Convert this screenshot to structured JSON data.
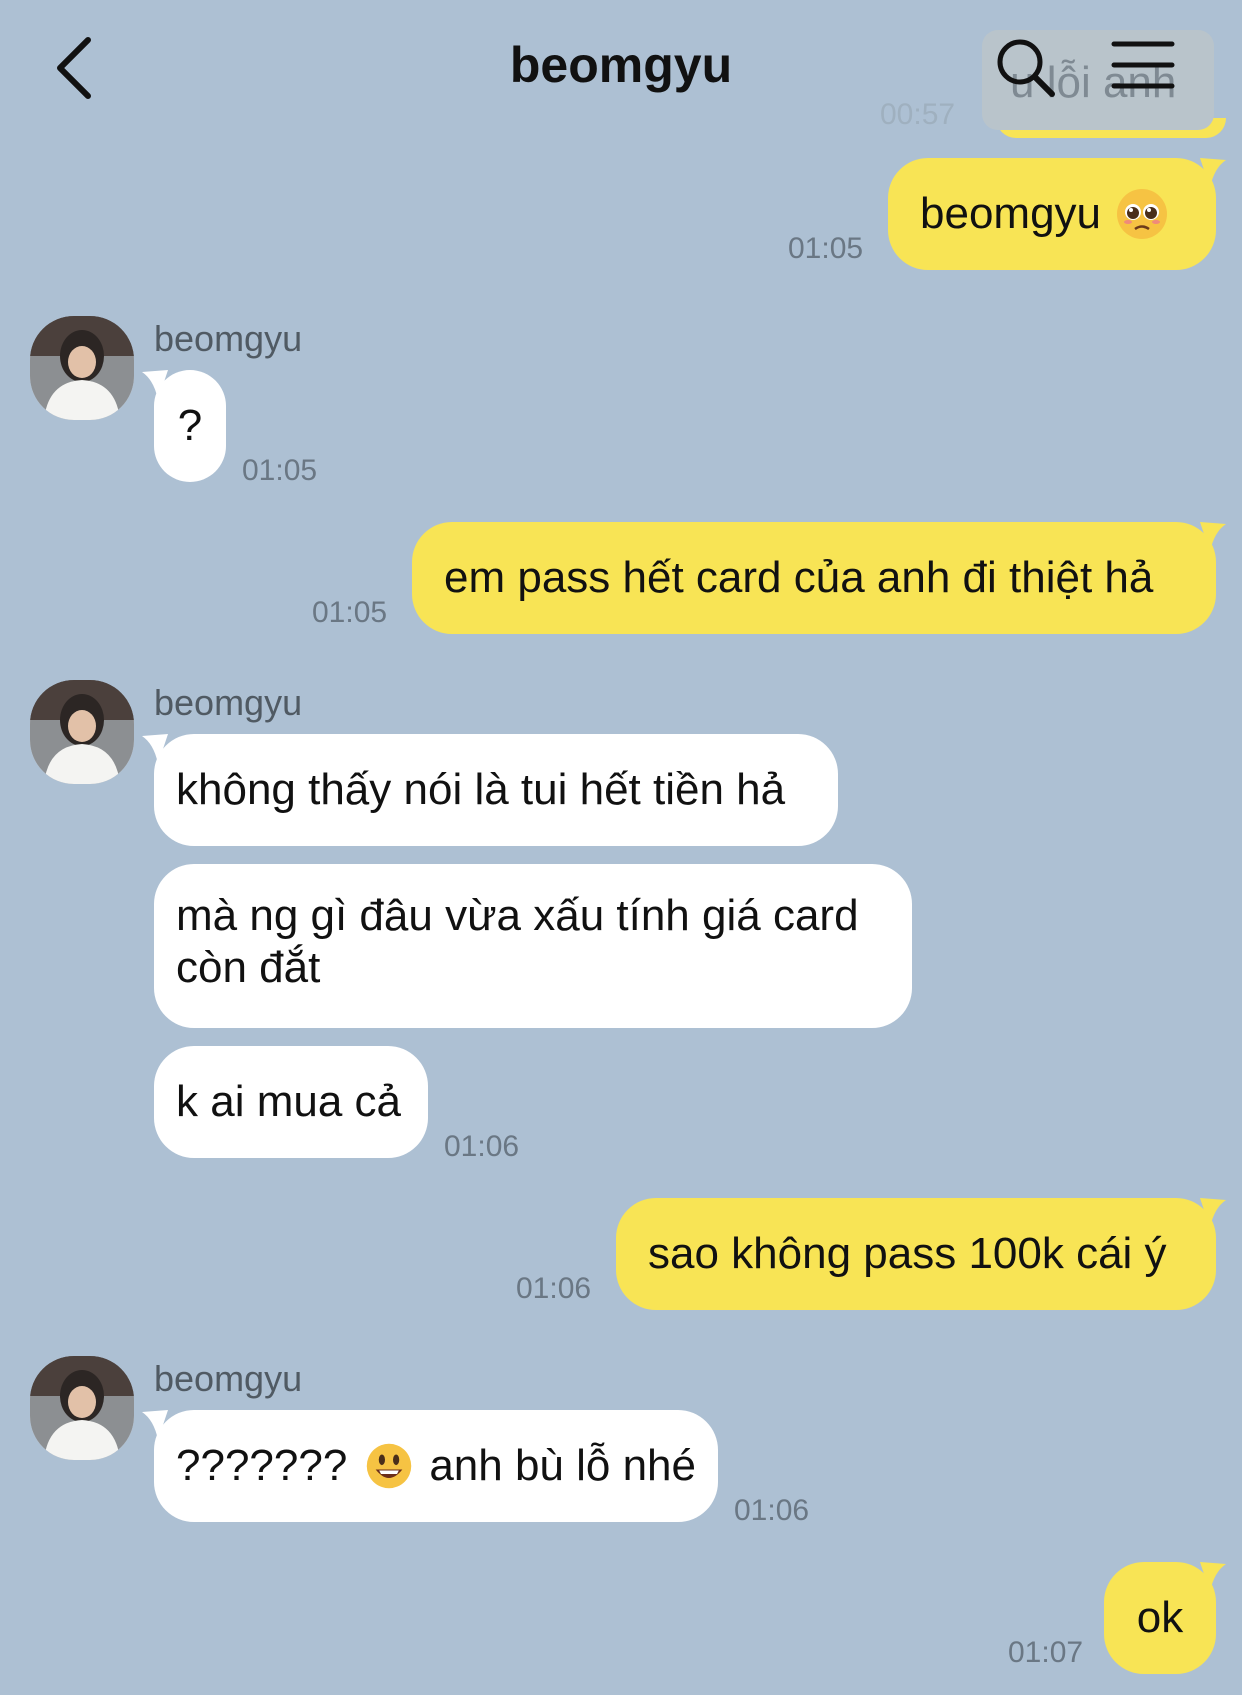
{
  "header": {
    "title": "beomgyu",
    "partial_prev_text": "u lỗi anh",
    "partial_prev_time": "00:57"
  },
  "icons": {
    "back": "chevron-left-icon",
    "search": "search-icon",
    "menu": "hamburger-menu-icon"
  },
  "colors": {
    "background": "#adc0d3",
    "my_bubble": "#f8e455",
    "their_bubble": "#ffffff"
  },
  "messages": [
    {
      "from": "me",
      "text": "beomgyu",
      "emoji": "pleading-face-emoji",
      "time": "01:05"
    },
    {
      "from": "them",
      "sender": "beomgyu",
      "text": "?",
      "time": "01:05"
    },
    {
      "from": "me",
      "text": "em pass hết card của anh đi thiệt hả",
      "time": "01:05"
    },
    {
      "from": "them",
      "sender": "beomgyu",
      "text": "không thấy nói là tui hết tiền hả"
    },
    {
      "from": "them",
      "text": "mà ng gì đâu vừa xấu tính giá card còn đắt"
    },
    {
      "from": "them",
      "text": "k ai mua cả",
      "time": "01:06"
    },
    {
      "from": "me",
      "text": "sao không pass 100k cái ý",
      "time": "01:06"
    },
    {
      "from": "them",
      "sender": "beomgyu",
      "text_before_emoji": "???????",
      "emoji": "smiley-face-emoji",
      "text_after_emoji": "anh bù lỗ nhé",
      "time": "01:06"
    },
    {
      "from": "me",
      "text": "ok",
      "time": "01:07"
    }
  ]
}
